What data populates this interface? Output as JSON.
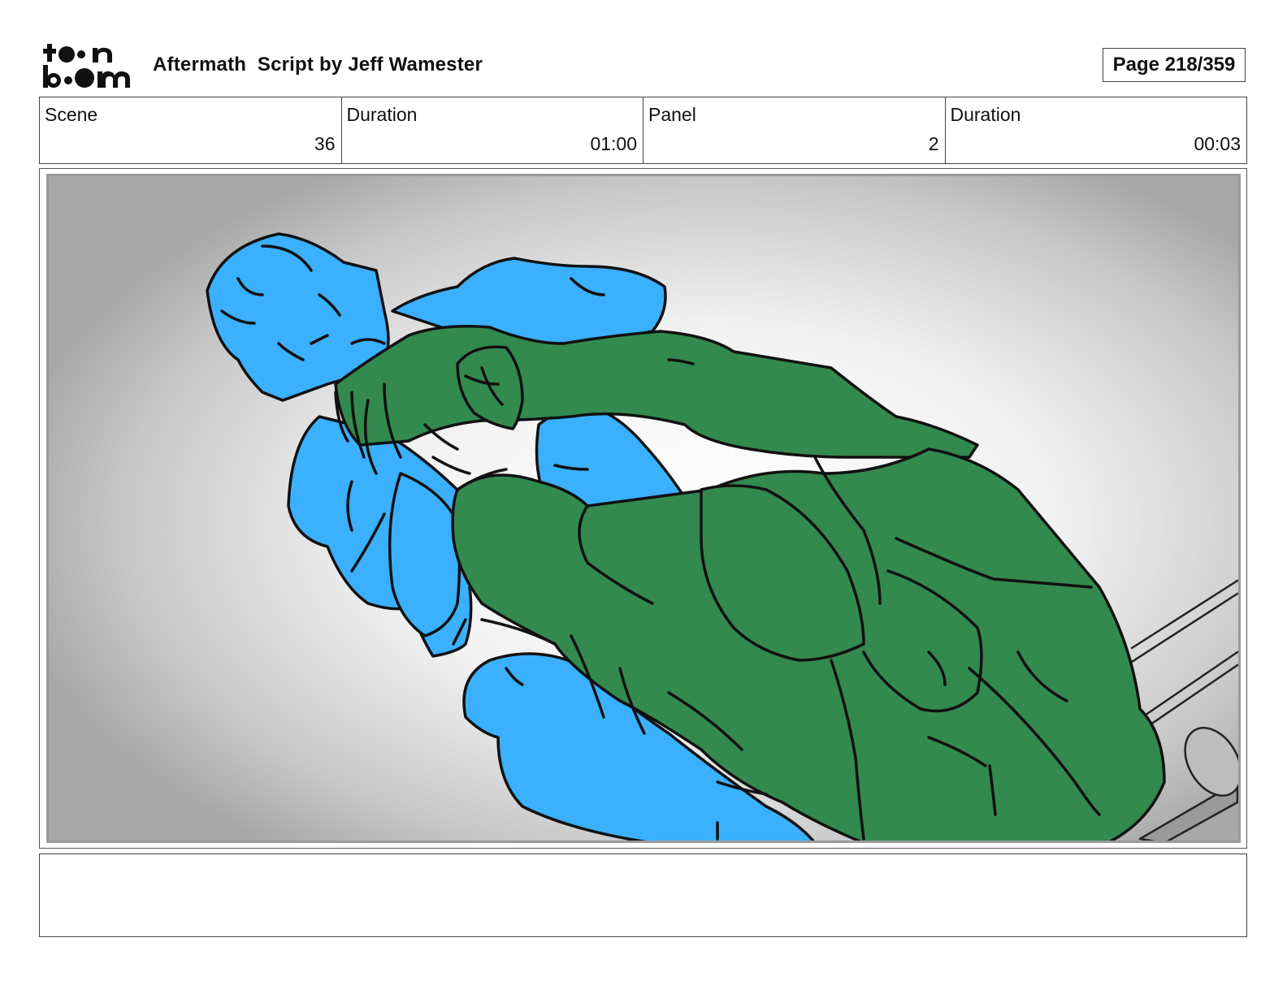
{
  "header": {
    "logo_text": "toon boom",
    "title": "Aftermath  Script by Jeff Wamester",
    "page": "Page 218/359"
  },
  "info": [
    {
      "label": "Scene",
      "value": "36"
    },
    {
      "label": "Duration",
      "value": "01:00"
    },
    {
      "label": "Panel",
      "value": "2"
    },
    {
      "label": "Duration",
      "value": "00:03"
    }
  ],
  "panel": {
    "figure_colors": {
      "left_figure": "#3bb0ff",
      "right_figure": "#338a4e",
      "outline": "#111111"
    }
  },
  "notes": {
    "text": ""
  }
}
